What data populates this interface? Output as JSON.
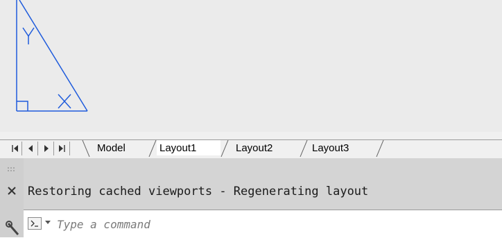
{
  "layout_tabs": {
    "items": [
      {
        "label": "Model",
        "active": false
      },
      {
        "label": "Layout1",
        "active": true
      },
      {
        "label": "Layout2",
        "active": false
      },
      {
        "label": "Layout3",
        "active": false
      }
    ],
    "nav_icons": [
      "first-tab-icon",
      "previous-tab-icon",
      "next-tab-icon",
      "last-tab-icon"
    ]
  },
  "ucs_icon": {
    "y_label": "Y",
    "x_label": "X",
    "color": "#1e5bdc"
  },
  "command_line": {
    "history_text": "Restoring cached viewports - Regenerating layout",
    "placeholder": "Type a command",
    "value": "",
    "icons": [
      "close-icon",
      "customize-wrench-icon",
      "command-prompt-icon",
      "recent-commands-dropdown-icon"
    ]
  },
  "colors": {
    "canvas_bg": "#ebebeb",
    "command_bar_bg": "#d4d4d4",
    "active_tab_bg": "#ffffff"
  }
}
